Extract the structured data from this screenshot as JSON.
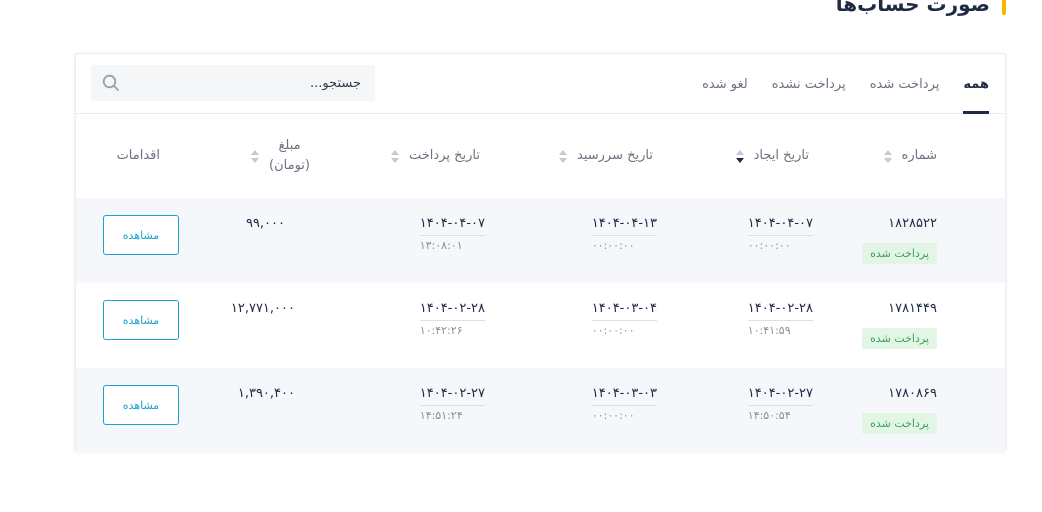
{
  "page": {
    "title": "صورت حساب‌ها"
  },
  "tabs": [
    {
      "label": "همه",
      "active": true
    },
    {
      "label": "پرداخت شده",
      "active": false
    },
    {
      "label": "پرداخت نشده",
      "active": false
    },
    {
      "label": "لغو شده",
      "active": false
    }
  ],
  "search": {
    "placeholder": "جستجو..."
  },
  "columns": {
    "number": "شماره",
    "created": "تاریخ ایجاد",
    "due": "تاریخ سررسید",
    "paid": "تاریخ پرداخت",
    "amount": "مبلغ",
    "amount_unit": "(تومان)",
    "actions": "اقدامات"
  },
  "rows": [
    {
      "number": "۱۸۲۸۵۲۲",
      "status": "پرداخت شده",
      "created_date": "۱۴۰۴-۰۴-۰۷",
      "created_time": "۰۰:۰۰:۰۰",
      "due_date": "۱۴۰۴-۰۴-۱۳",
      "due_time": "۰۰:۰۰:۰۰",
      "paid_date": "۱۴۰۴-۰۴-۰۷",
      "paid_time": "۱۳:۰۸:۰۱",
      "amount": "۹۹,۰۰۰",
      "action": "مشاهده"
    },
    {
      "number": "۱۷۸۱۴۴۹",
      "status": "پرداخت شده",
      "created_date": "۱۴۰۴-۰۲-۲۸",
      "created_time": "۱۰:۴۱:۵۹",
      "due_date": "۱۴۰۴-۰۳-۰۴",
      "due_time": "۰۰:۰۰:۰۰",
      "paid_date": "۱۴۰۴-۰۲-۲۸",
      "paid_time": "۱۰:۴۲:۲۶",
      "amount": "۱۲,۷۷۱,۰۰۰",
      "action": "مشاهده"
    },
    {
      "number": "۱۷۸۰۸۶۹",
      "status": "پرداخت شده",
      "created_date": "۱۴۰۴-۰۲-۲۷",
      "created_time": "۱۴:۵۰:۵۴",
      "due_date": "۱۴۰۴-۰۳-۰۳",
      "due_time": "۰۰:۰۰:۰۰",
      "paid_date": "۱۴۰۴-۰۲-۲۷",
      "paid_time": "۱۴:۵۱:۲۴",
      "amount": "۱,۳۹۰,۴۰۰",
      "action": "مشاهده"
    }
  ]
}
